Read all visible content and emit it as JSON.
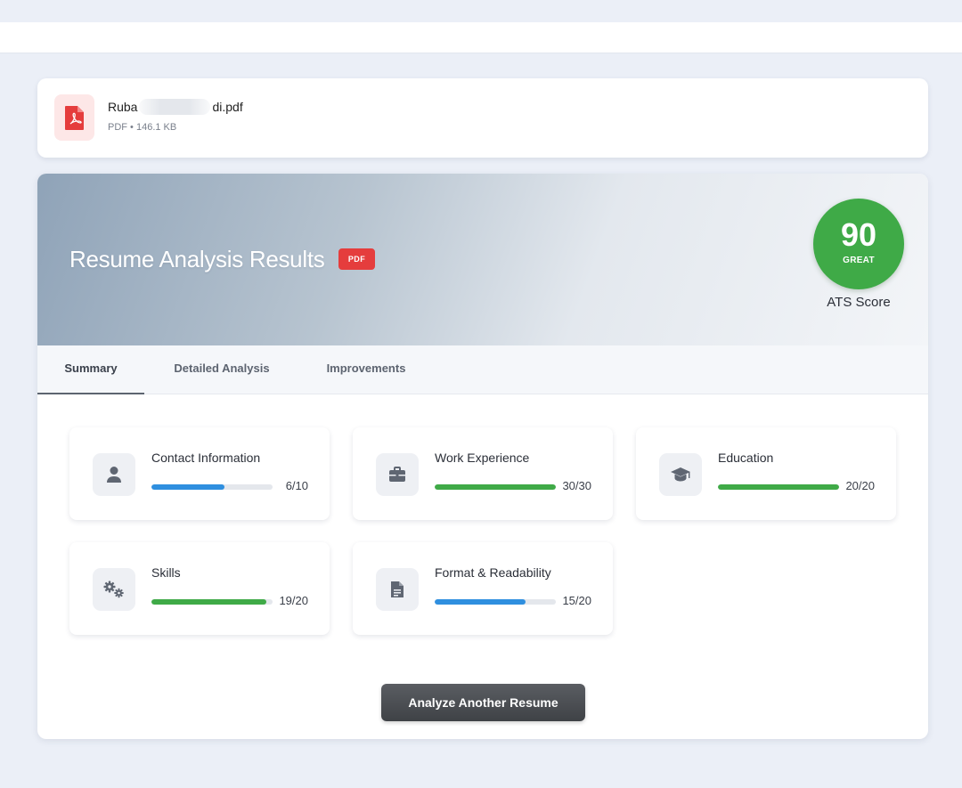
{
  "file": {
    "name_start": "Ruba",
    "name_end": "di.pdf",
    "meta": "PDF • 146.1 KB",
    "icon": "pdf-file-icon"
  },
  "results": {
    "title": "Resume Analysis Results",
    "badge": "PDF",
    "score": {
      "value": "90",
      "label": "GREAT",
      "caption": "ATS Score",
      "color": "#3faa47"
    },
    "tabs": [
      {
        "label": "Summary",
        "active": true
      },
      {
        "label": "Detailed Analysis",
        "active": false
      },
      {
        "label": "Improvements",
        "active": false
      }
    ],
    "metrics": [
      {
        "title": "Contact Information",
        "score": "6/10",
        "fraction": 0.6,
        "color": "#2f8fdf",
        "icon": "user-icon"
      },
      {
        "title": "Work Experience",
        "score": "30/30",
        "fraction": 1.0,
        "color": "#3faa47",
        "icon": "briefcase-icon"
      },
      {
        "title": "Education",
        "score": "20/20",
        "fraction": 1.0,
        "color": "#3faa47",
        "icon": "graduation-cap-icon"
      },
      {
        "title": "Skills",
        "score": "19/20",
        "fraction": 0.95,
        "color": "#3faa47",
        "icon": "gears-icon"
      },
      {
        "title": "Format & Readability",
        "score": "15/20",
        "fraction": 0.75,
        "color": "#2f8fdf",
        "icon": "document-icon"
      }
    ],
    "button": "Analyze Another Resume"
  }
}
